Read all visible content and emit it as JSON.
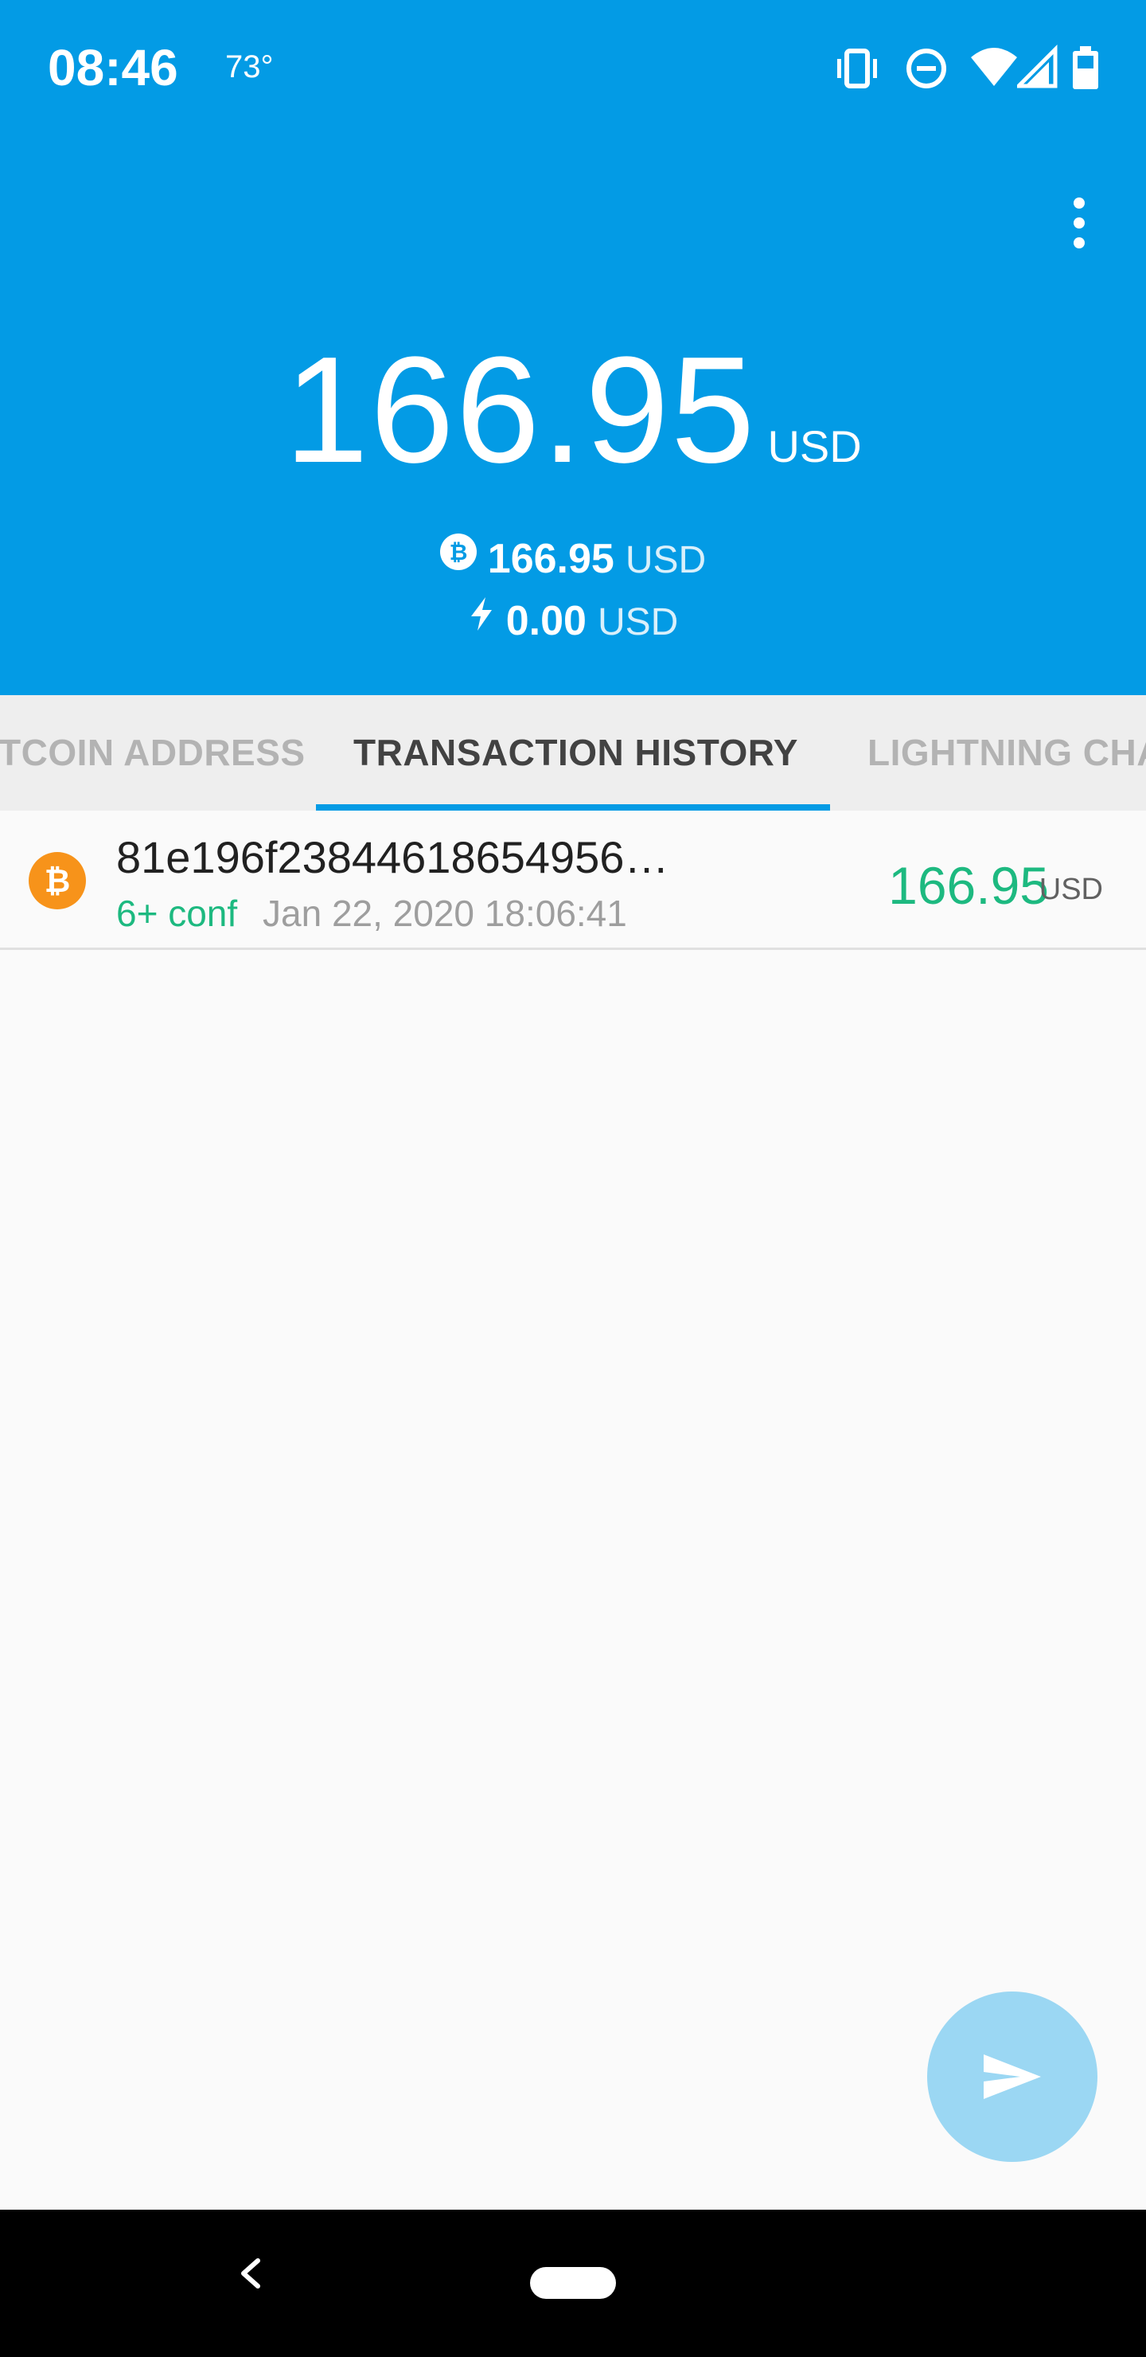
{
  "status_bar": {
    "time": "08:46",
    "temperature": "73°",
    "icons": [
      "vibrate-icon",
      "do-not-disturb-icon",
      "wifi-icon",
      "signal-icon",
      "battery-icon"
    ]
  },
  "header": {
    "menu_icon": "more-vert-icon",
    "balance": {
      "amount": "166.95",
      "unit": "USD"
    },
    "onchain": {
      "icon": "bitcoin-icon",
      "amount": "166.95",
      "unit": "USD"
    },
    "lightning": {
      "icon": "lightning-icon",
      "amount": "0.00",
      "unit": "USD"
    }
  },
  "tabs": [
    {
      "label": "BITCOIN ADDRESS",
      "visible_label": "TCOIN ADDRESS",
      "active": false
    },
    {
      "label": "TRANSACTION HISTORY",
      "active": true
    },
    {
      "label": "LIGHTNING CHANNELS",
      "visible_label": "LIGHTNING CHA",
      "active": false
    }
  ],
  "transactions": [
    {
      "icon": "bitcoin-icon",
      "id": "81e196f23844618654956…",
      "confirmations": "6+ conf",
      "date": "Jan 22, 2020 18:06:41",
      "amount": "166.95",
      "unit": "USD"
    }
  ],
  "fab": {
    "icon": "send-icon"
  },
  "colors": {
    "primary": "#039be5",
    "positive": "#1db980",
    "bitcoin": "#f7931a",
    "fab": "#9bd7f3"
  }
}
